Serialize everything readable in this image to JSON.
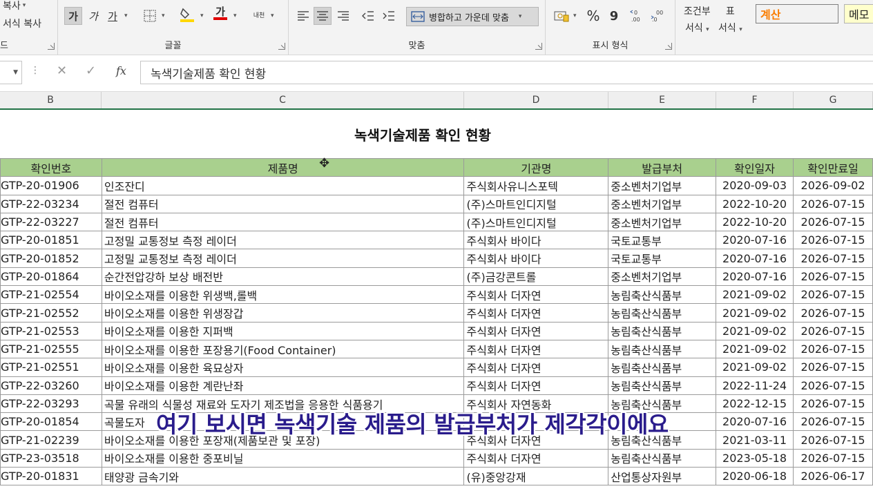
{
  "ribbon": {
    "clipboard": {
      "copy_label": "복사",
      "format_painter_label": "서식 복사",
      "group_label": "드"
    },
    "font": {
      "bold_glyph": "가",
      "italic_glyph": "가",
      "underline_glyph": "가",
      "font_color_glyph": "가",
      "phonetic_glyph": "내천",
      "group_label": "글꼴",
      "fill_color": "#ffd700",
      "font_color": "#e00000"
    },
    "alignment": {
      "merge_center_label": "병합하고 가운데 맞춤",
      "group_label": "맞춤"
    },
    "number": {
      "percent_glyph": "%",
      "comma_glyph": "9",
      "group_label": "표시 형식"
    },
    "styles": {
      "conditional_label_line1": "조건부",
      "conditional_label_line2": "서식",
      "table_label_line1": "표",
      "table_label_line2": "서식",
      "style_calc": "계산",
      "style_memo": "메모"
    }
  },
  "formula_bar": {
    "content": "녹색기술제품 확인 현황",
    "fx_label": "fx"
  },
  "columns": [
    "B",
    "C",
    "D",
    "E",
    "F",
    "G"
  ],
  "sheet": {
    "title": "녹색기술제품 확인 현황",
    "headers": [
      "확인번호",
      "제품명",
      "기관명",
      "발급부처",
      "확인일자",
      "확인만료일"
    ],
    "rows": [
      [
        "GTP-20-01906",
        "인조잔디",
        "주식회사유니스포텍",
        "중소벤처기업부",
        "2020-09-03",
        "2026-09-02"
      ],
      [
        "GTP-22-03234",
        "절전 컴퓨터",
        "(주)스마트인디지털",
        "중소벤처기업부",
        "2022-10-20",
        "2026-07-15"
      ],
      [
        "GTP-22-03227",
        "절전 컴퓨터",
        "(주)스마트인디지털",
        "중소벤처기업부",
        "2022-10-20",
        "2026-07-15"
      ],
      [
        "GTP-20-01851",
        "고정밀 교통정보 측정 레이더",
        "주식회사 바이다",
        "국토교통부",
        "2020-07-16",
        "2026-07-15"
      ],
      [
        "GTP-20-01852",
        "고정밀 교통정보 측정 레이더",
        "주식회사 바이다",
        "국토교통부",
        "2020-07-16",
        "2026-07-15"
      ],
      [
        "GTP-20-01864",
        "순간전압강하 보상 배전반",
        "(주)금강콘트롤",
        "중소벤처기업부",
        "2020-07-16",
        "2026-07-15"
      ],
      [
        "GTP-21-02554",
        "바이오소재를 이용한 위생백,롤백",
        "주식회사 더자연",
        "농림축산식품부",
        "2021-09-02",
        "2026-07-15"
      ],
      [
        "GTP-21-02552",
        "바이오소재를 이용한 위생장갑",
        "주식회사 더자연",
        "농림축산식품부",
        "2021-09-02",
        "2026-07-15"
      ],
      [
        "GTP-21-02553",
        "바이오소재를 이용한 지퍼백",
        "주식회사 더자연",
        "농림축산식품부",
        "2021-09-02",
        "2026-07-15"
      ],
      [
        "GTP-21-02555",
        "바이오소재를 이용한 포장용기(Food Container)",
        "주식회사 더자연",
        "농림축산식품부",
        "2021-09-02",
        "2026-07-15"
      ],
      [
        "GTP-21-02551",
        "바이오소재를 이용한 육묘상자",
        "주식회사 더자연",
        "농림축산식품부",
        "2021-09-02",
        "2026-07-15"
      ],
      [
        "GTP-22-03260",
        "바이오소재를 이용한 계란난좌",
        "주식회사 더자연",
        "농림축산식품부",
        "2022-11-24",
        "2026-07-15"
      ],
      [
        "GTP-22-03293",
        "곡물 유래의 식물성 재료와 도자기 제조법을 응용한 식품용기",
        "주식회사 자연동화",
        "농림축산식품부",
        "2022-12-15",
        "2026-07-15"
      ],
      [
        "GTP-20-01854",
        "곡물도자",
        "",
        "",
        "2020-07-16",
        "2026-07-15"
      ],
      [
        "GTP-21-02239",
        "바이오소재를 이용한 포장재(제품보관 및 포장)",
        "주식회사 더자연",
        "농림축산식품부",
        "2021-03-11",
        "2026-07-15"
      ],
      [
        "GTP-23-03518",
        "바이오소재를 이용한 중포비닐",
        "주식회사 더자연",
        "농림축산식품부",
        "2023-05-18",
        "2026-07-15"
      ],
      [
        "GTP-20-01831",
        "태양광 금속기와",
        "(유)중앙강재",
        "산업통상자원부",
        "2020-06-18",
        "2026-06-17"
      ]
    ]
  },
  "caption": "여기 보시면 녹색기술 제품의 발급부처가 제각각이에요"
}
